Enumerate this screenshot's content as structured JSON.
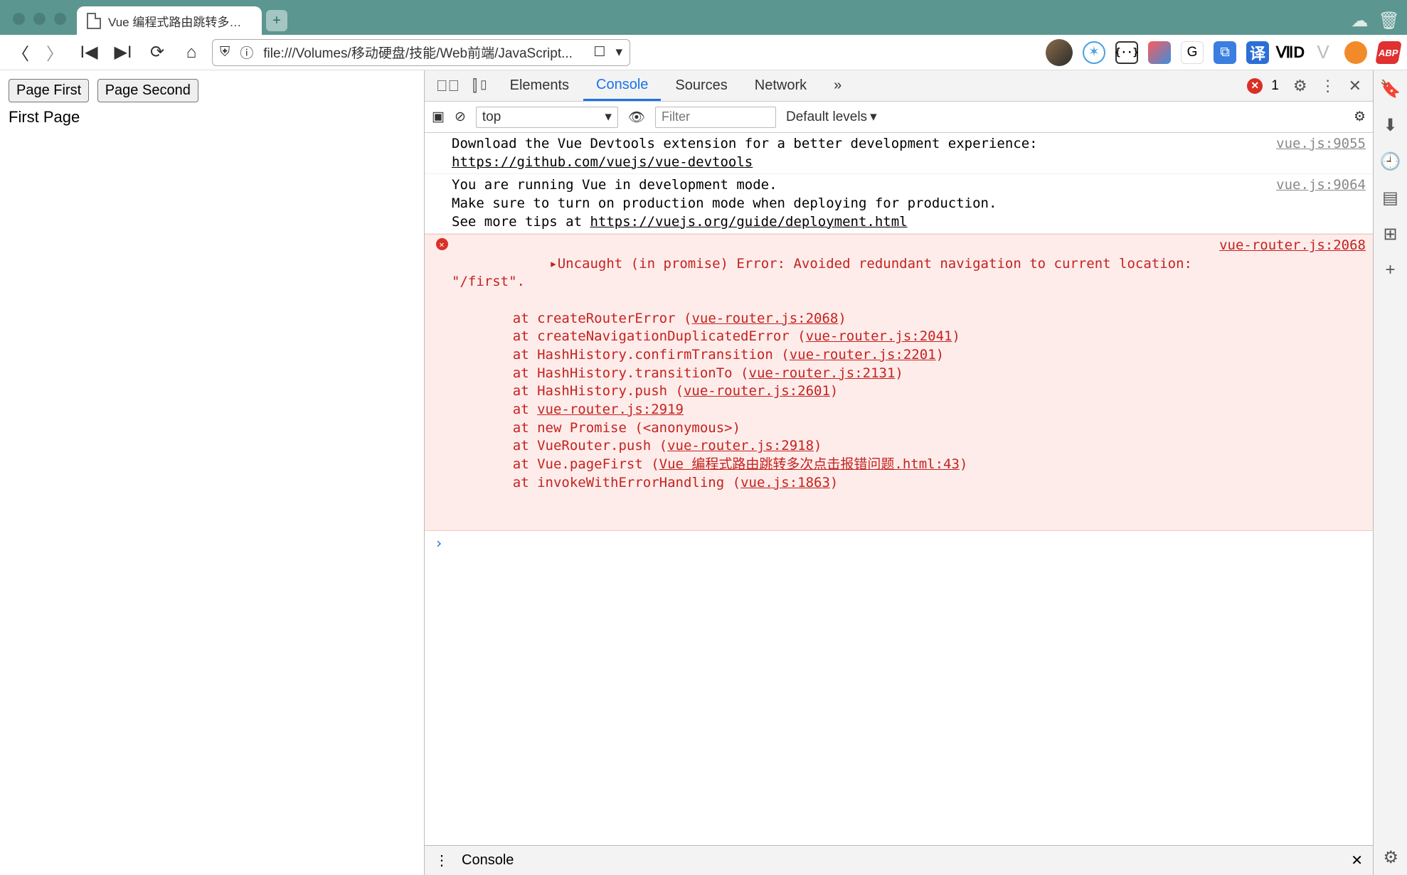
{
  "browser": {
    "tab_title": "Vue 编程式路由跳转多次点",
    "url": "file:///Volumes/移动硬盘/技能/Web前端/JavaScript..."
  },
  "page": {
    "buttons": [
      "Page First",
      "Page Second"
    ],
    "heading": "First Page"
  },
  "devtools": {
    "tabs": [
      "Elements",
      "Console",
      "Sources",
      "Network"
    ],
    "active_tab": "Console",
    "more": "»",
    "error_count": "1",
    "console_toolbar": {
      "context": "top",
      "filter_placeholder": "Filter",
      "levels": "Default levels"
    },
    "logs": [
      {
        "type": "log",
        "text": "Download the Vue Devtools extension for a better development experience:\n",
        "link": "https://github.com/vuejs/vue-devtools",
        "source": "vue.js:9055"
      },
      {
        "type": "log",
        "text": "You are running Vue in development mode.\nMake sure to turn on production mode when deploying for production.\nSee more tips at ",
        "link": "https://vuejs.org/guide/deployment.html",
        "source": "vue.js:9064"
      }
    ],
    "error": {
      "source": "vue-router.js:2068",
      "header": "Uncaught (in promise) Error: Avoided redundant navigation to current location: \"/first\".",
      "stack": [
        {
          "pre": "at createRouterError (",
          "link": "vue-router.js:2068",
          "post": ")"
        },
        {
          "pre": "at createNavigationDuplicatedError (",
          "link": "vue-router.js:2041",
          "post": ")"
        },
        {
          "pre": "at HashHistory.confirmTransition (",
          "link": "vue-router.js:2201",
          "post": ")"
        },
        {
          "pre": "at HashHistory.transitionTo (",
          "link": "vue-router.js:2131",
          "post": ")"
        },
        {
          "pre": "at HashHistory.push (",
          "link": "vue-router.js:2601",
          "post": ")"
        },
        {
          "pre": "at ",
          "link": "vue-router.js:2919",
          "post": ""
        },
        {
          "pre": "at new Promise (<anonymous>)",
          "link": "",
          "post": ""
        },
        {
          "pre": "at VueRouter.push (",
          "link": "vue-router.js:2918",
          "post": ")"
        },
        {
          "pre": "at Vue.pageFirst (",
          "link": "Vue 编程式路由跳转多次点击报错问题.html:43",
          "post": ")"
        },
        {
          "pre": "at invokeWithErrorHandling (",
          "link": "vue.js:1863",
          "post": ")"
        }
      ]
    },
    "drawer_label": "Console"
  }
}
